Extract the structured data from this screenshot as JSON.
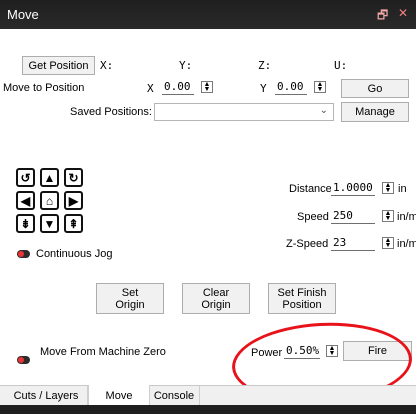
{
  "window": {
    "title": "Move",
    "restore_glyph": "🗗",
    "close_glyph": "✕"
  },
  "position": {
    "get_position_label": "Get Position",
    "x_label": "X:",
    "y_label": "Y:",
    "z_label": "Z:",
    "u_label": "U:",
    "move_to_label": "Move to Position",
    "move_x_label": "X",
    "move_x_value": "0.00",
    "move_y_label": "Y",
    "move_y_value": "0.00",
    "go_label": "Go",
    "saved_label": "Saved Positions:",
    "saved_value": "",
    "manage_label": "Manage"
  },
  "jog": {
    "distance_label": "Distance",
    "distance_value": "1.0000",
    "distance_unit": "in",
    "speed_label": "Speed",
    "speed_value": "250",
    "speed_unit": "in/m",
    "zspeed_label": "Z-Speed",
    "zspeed_value": "23",
    "zspeed_unit": "in/m",
    "continuous_label": "Continuous Jog",
    "icons": [
      "rotate-ccw-icon",
      "arrow-up-icon",
      "rotate-cw-icon",
      "arrow-left-icon",
      "home-icon",
      "arrow-right-icon",
      "z-down-icon",
      "arrow-down-icon",
      "z-up-icon"
    ]
  },
  "actions": {
    "set_origin_1": "Set",
    "set_origin_2": "Origin",
    "clear_origin_1": "Clear",
    "clear_origin_2": "Origin",
    "set_finish_1": "Set Finish",
    "set_finish_2": "Position"
  },
  "bottom_controls": {
    "move_from_zero_label": "Move From Machine Zero",
    "power_label": "Power",
    "power_value": "0.50%",
    "fire_label": "Fire"
  },
  "tabs": [
    {
      "label": "Cuts / Layers"
    },
    {
      "label": "Move"
    },
    {
      "label": "Console"
    }
  ],
  "colors": {
    "titlebar": "#1f1f1f",
    "annotation": "#e8121a",
    "toggle_on": "#e33333"
  }
}
